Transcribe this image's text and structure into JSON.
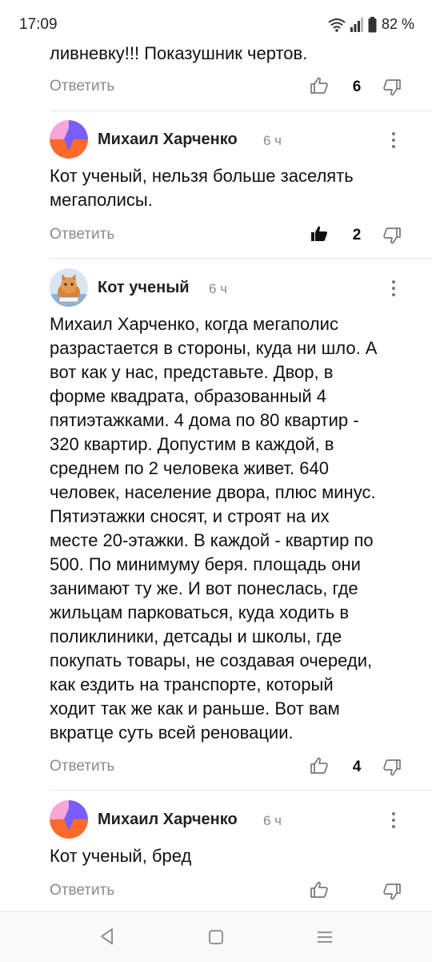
{
  "status": {
    "time": "17:09",
    "battery": "82 %"
  },
  "actions": {
    "reply_label": "Ответить"
  },
  "comments": [
    {
      "text": "ливневку!!! Показушник чертов.",
      "votes": "6"
    },
    {
      "author": "Михаил Харченко",
      "time": "6 ч",
      "text_lines": [
        "Кот ученый, нельзя больше заселять",
        "мегаполисы."
      ],
      "votes": "2",
      "liked": true
    },
    {
      "author": "Кот ученый",
      "time": "6 ч",
      "text_lines": [
        "Михаил Харченко, когда мегаполис",
        "разрастается в стороны, куда ни шло. А",
        "вот как у нас, представьте. Двор, в",
        "форме квадрата, образованный 4",
        "пятиэтажками. 4 дома по 80 квартир -",
        "320 квартир. Допустим в каждой, в",
        "среднем по 2 человека живет. 640",
        "человек, население двора, плюс минус.",
        "Пятиэтажки сносят, и строят на их",
        "месте 20-этажки. В каждой - квартир по",
        "500. По минимуму беря. площадь они",
        "занимают ту же. И вот понеслась, где",
        "жильцам парковаться, куда ходить в",
        "поликлиники, детсады и школы, где",
        "покупать товары, не создавая очереди,",
        "как ездить на транспорте, который",
        "ходит так же как и раньше. Вот вам",
        "вкратце суть всей реновации."
      ],
      "votes": "4"
    },
    {
      "author": "Михаил Харченко",
      "time": "6 ч",
      "text": "Кот ученый, бред",
      "votes": ""
    }
  ],
  "icons": [
    "wifi-icon",
    "signal-icon",
    "battery-icon",
    "thumbs-up-icon",
    "thumbs-down-icon",
    "more-vertical-icon",
    "back-nav-icon",
    "home-nav-icon",
    "recents-nav-icon"
  ],
  "colors": {
    "reply": "#8b8b8b",
    "avatar_purple": "#7a5cff",
    "avatar_orange": "#ff6a2a",
    "avatar_pink": "#f7a6d8"
  }
}
